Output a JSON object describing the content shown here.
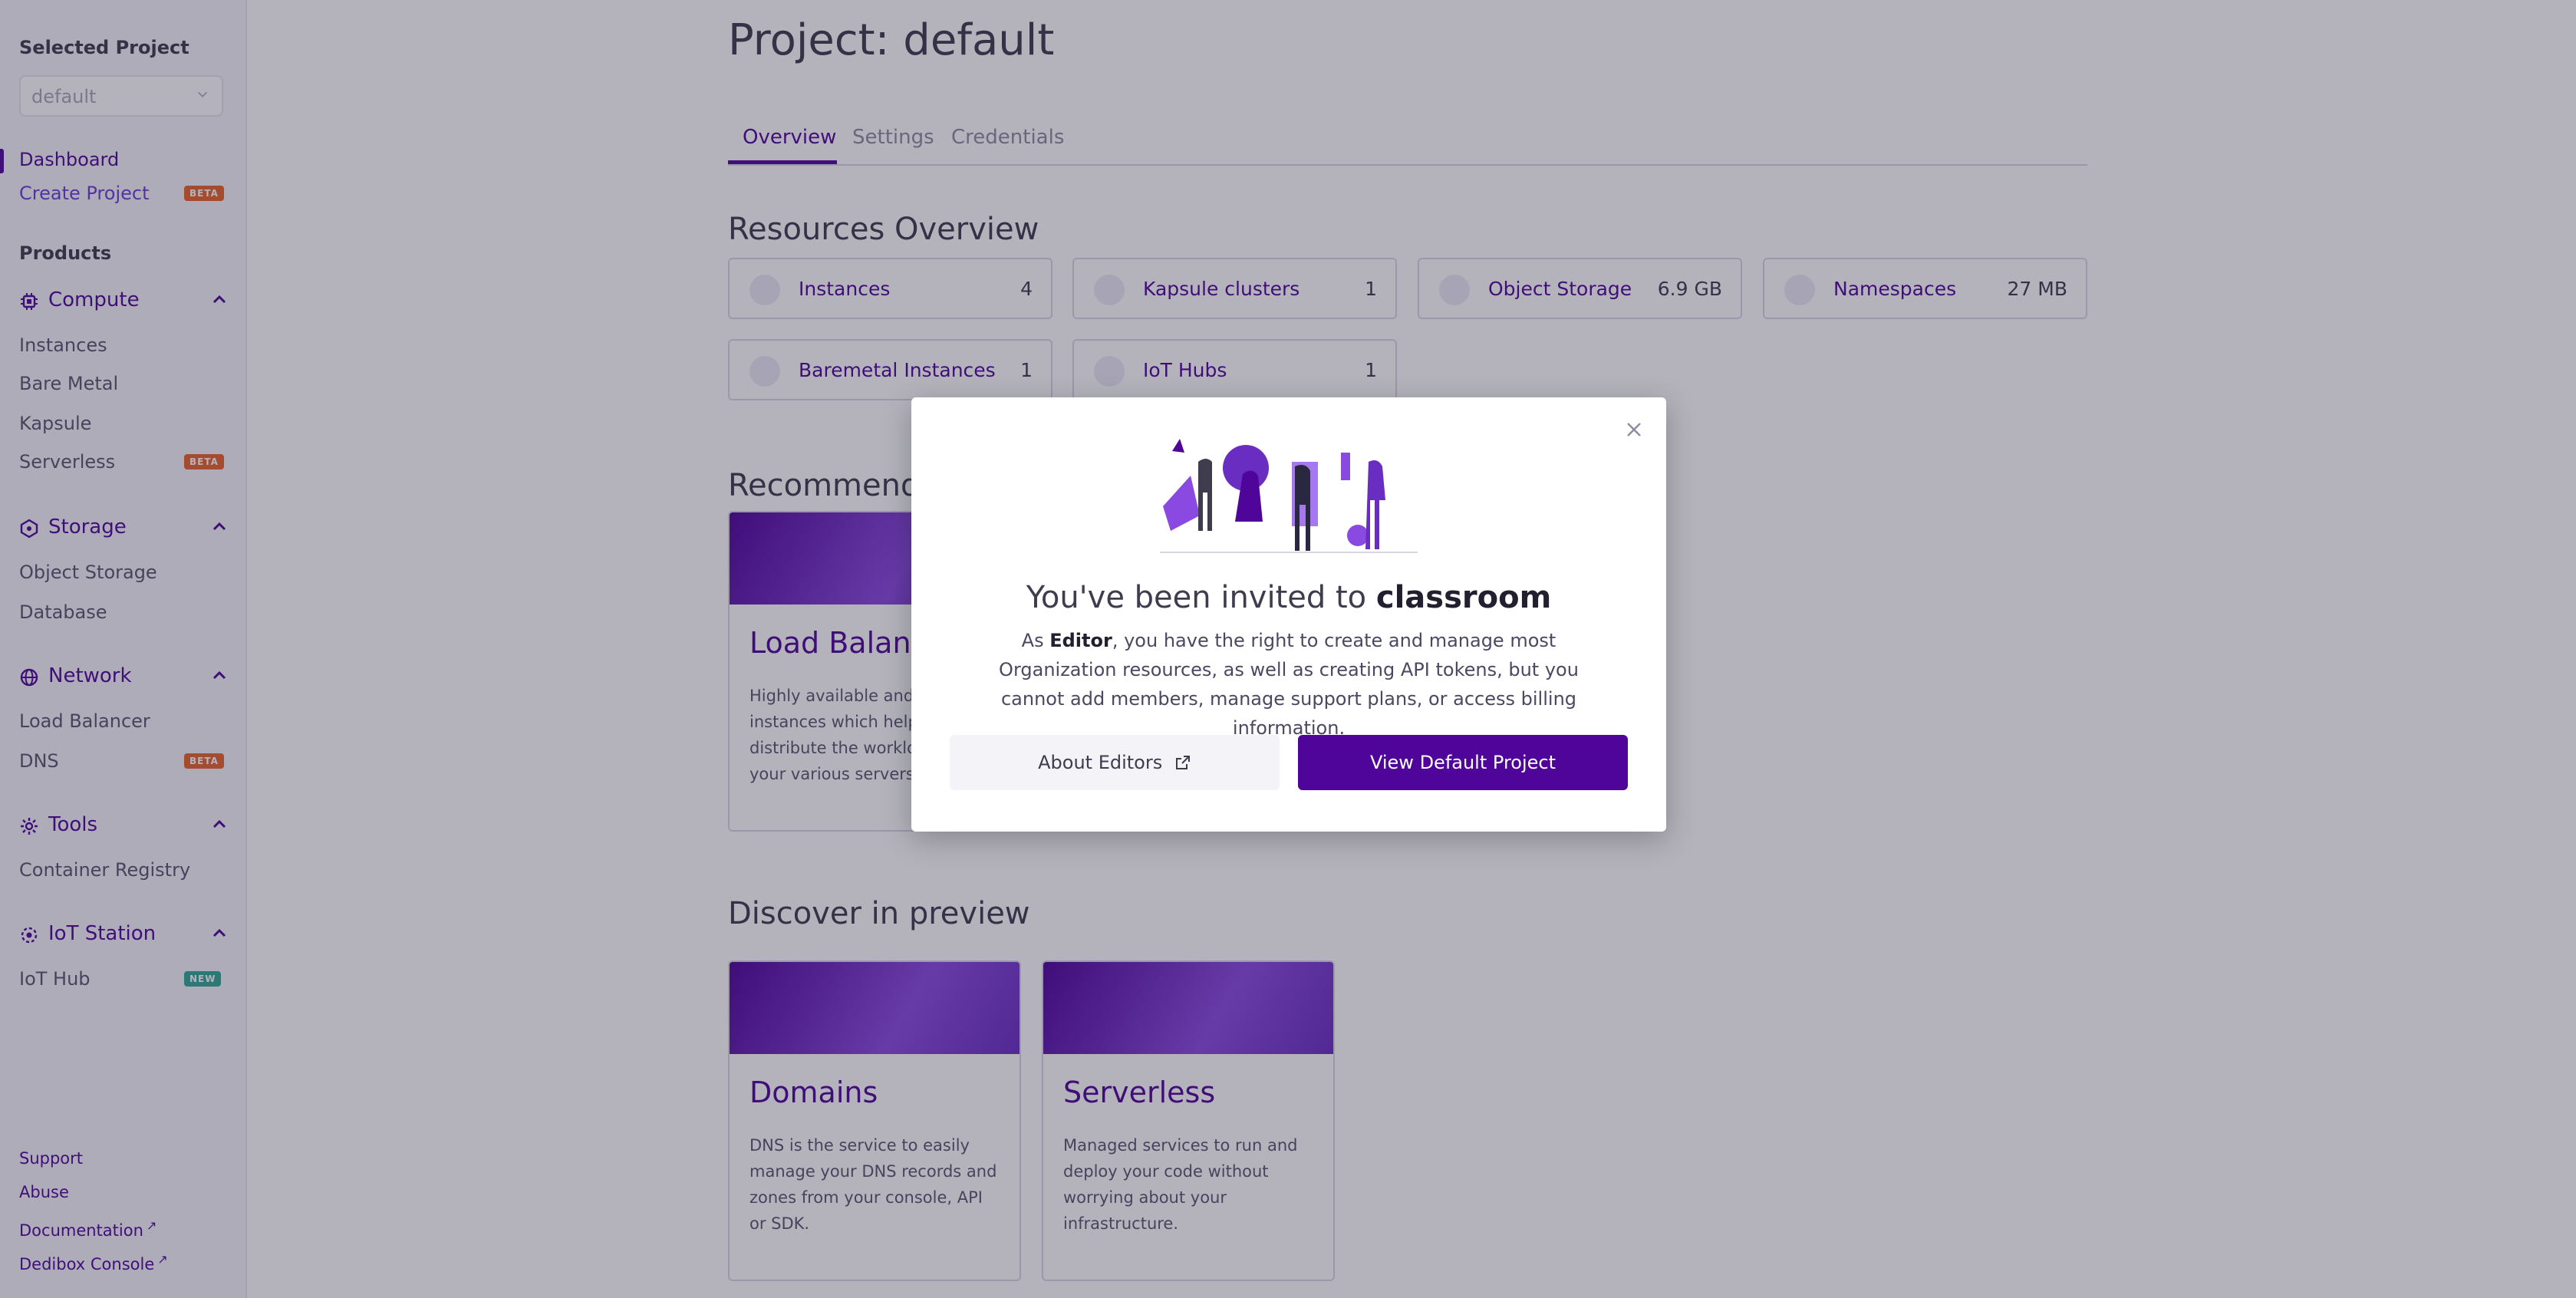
{
  "sidebar": {
    "project_label": "Selected Project",
    "project_select_value": "default",
    "dashboard_label": "Dashboard",
    "create_project_label": "Create Project",
    "create_project_badge": "BETA",
    "products_heading": "Products",
    "groups": {
      "compute": {
        "label": "Compute",
        "items": [
          "Instances",
          "Bare Metal",
          "Kapsule",
          "Serverless"
        ],
        "serverless_badge": "BETA"
      },
      "storage": {
        "label": "Storage",
        "items": [
          "Object Storage",
          "Database"
        ]
      },
      "network": {
        "label": "Network",
        "items": [
          "Load Balancer",
          "DNS"
        ],
        "dns_badge": "BETA"
      },
      "tools": {
        "label": "Tools",
        "items": [
          "Container Registry"
        ]
      },
      "iot": {
        "label": "IoT Station",
        "items": [
          "IoT Hub"
        ],
        "iothub_badge": "NEW"
      }
    },
    "footer": {
      "support": "Support",
      "abuse": "Abuse",
      "documentation": "Documentation",
      "dedibox": "Dedibox Console"
    }
  },
  "main": {
    "title": "Project: default",
    "tabs": [
      "Overview",
      "Settings",
      "Credentials"
    ],
    "active_tab": "Overview",
    "resources_title": "Resources Overview",
    "resources": [
      {
        "label": "Instances",
        "value": "4"
      },
      {
        "label": "Kapsule clusters",
        "value": "1"
      },
      {
        "label": "Object Storage",
        "value": "6.9 GB"
      },
      {
        "label": "Namespaces",
        "value": "27 MB"
      },
      {
        "label": "Baremetal Instances",
        "value": "1"
      },
      {
        "label": "IoT Hubs",
        "value": "1"
      }
    ],
    "recommended_title": "Recommended",
    "recommended_card": {
      "title": "Load Balancer",
      "desc": "Highly available and managed instances which help to distribute the workload among your various servers"
    },
    "discover_title": "Discover in preview",
    "discover_cards": [
      {
        "title": "Domains",
        "desc": "DNS is the service to easily manage your DNS records and zones from your console, API or SDK."
      },
      {
        "title": "Serverless",
        "desc": "Managed services to run and deploy your code without worrying about your infrastructure."
      }
    ]
  },
  "modal": {
    "title_prefix": "You've been invited to",
    "org_name": "classroom",
    "desc_prefix": "As",
    "role": "Editor",
    "desc_body": ", you have the right to create and manage most Organization resources, as well as creating API tokens, but you cannot add members, manage support plans, or access billing information.",
    "secondary_button": "About Editors",
    "primary_button": "View Default Project"
  },
  "colors": {
    "accent": "#4f0599",
    "beta_badge": "#e8622b",
    "new_badge": "#2fa896"
  }
}
